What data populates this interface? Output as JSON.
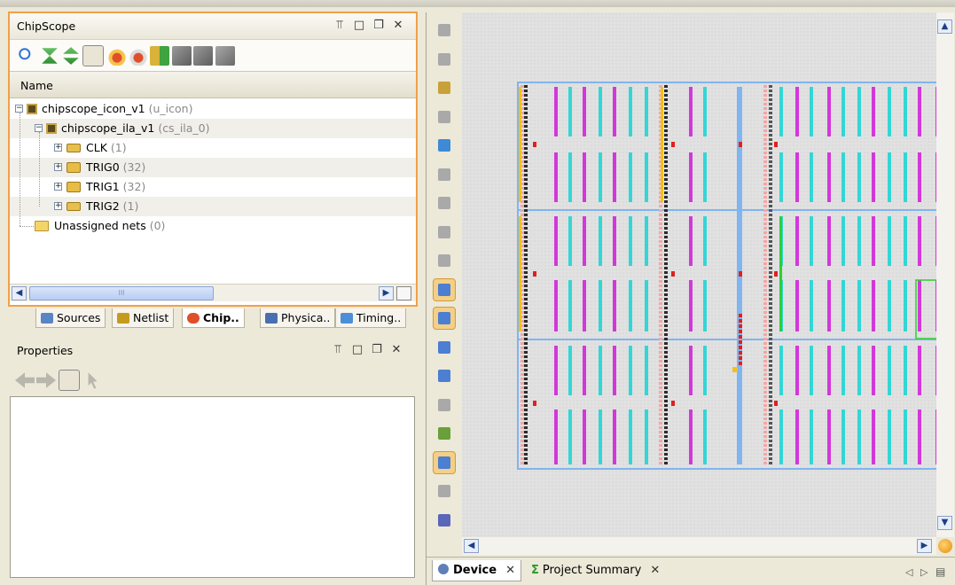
{
  "chipscope_panel": {
    "title": "ChipScope",
    "controls": [
      "pin-icon",
      "maximize-icon",
      "restore-icon",
      "close-icon"
    ],
    "control_glyphs": [
      "⫪",
      "□",
      "❐",
      "✕"
    ],
    "toolbar_icons": [
      "search-icon",
      "collapse-all-icon",
      "expand-all-icon",
      "group-by-icon",
      "add-probe-icon",
      "remove-probe-icon",
      "connect-net-icon",
      "add-trigger-icon",
      "add-data-icon",
      "delete-icon"
    ],
    "column_header": "Name",
    "tree": [
      {
        "label": "chipscope_icon_v1",
        "suffix": "(u_icon)"
      },
      {
        "label": "chipscope_ila_v1",
        "suffix": "(cs_ila_0)"
      },
      {
        "label": "CLK",
        "suffix": "(1)"
      },
      {
        "label": "TRIG0",
        "suffix": "(32)"
      },
      {
        "label": "TRIG1",
        "suffix": "(32)"
      },
      {
        "label": "TRIG2",
        "suffix": "(1)"
      },
      {
        "label": "Unassigned nets",
        "suffix": "(0)"
      }
    ],
    "expander_collapsed": "+",
    "expander_expanded": "−",
    "scroll_thumb_grip": "III",
    "scroll_left_glyph": "◀",
    "scroll_right_glyph": "▶"
  },
  "left_tabs": [
    {
      "label": "Sources",
      "icon": "sources-icon",
      "color": "#5b84c4"
    },
    {
      "label": "Netlist",
      "icon": "netlist-icon",
      "color": "#c59a1e"
    },
    {
      "label": "Chip..",
      "icon": "chipscope-icon",
      "color": "#e04e2a",
      "active": true
    },
    {
      "label": "Physica..",
      "icon": "physical-icon",
      "color": "#4a6fb0"
    },
    {
      "label": "Timing..",
      "icon": "timing-icon",
      "color": "#4d8fd6"
    }
  ],
  "properties_panel": {
    "title": "Properties",
    "controls": [
      "pin-icon",
      "maximize-icon",
      "restore-icon",
      "close-icon"
    ],
    "control_glyphs": [
      "⫪",
      "□",
      "❐",
      "✕"
    ],
    "toolbar_icons": [
      "back-icon",
      "forward-icon",
      "settings-icon",
      "select-icon"
    ]
  },
  "device_panel": {
    "tabs": [
      {
        "label": "Device",
        "icon": "device-icon",
        "active": true
      },
      {
        "label": "Project Summary",
        "icon": "sigma-icon",
        "active": false
      }
    ],
    "close_glyph": "✕",
    "right_glyphs": [
      "◁",
      "▷",
      "▤"
    ],
    "vtoolbar": [
      "back-icon",
      "forward-icon",
      "select-area-icon",
      "pan-icon",
      "add-pblock-icon",
      "place-icon",
      "route-icon",
      "show-io-icon",
      "show-clock-icon",
      "routing-icon",
      "zoom-fit-icon",
      "relocate-icon",
      "draw-icon",
      "cross-probe-icon",
      "mark-icon",
      "unmark-icon",
      "unplace-icon",
      "zoom-icon"
    ],
    "vtoolbar_pressed": [
      9,
      10,
      15
    ],
    "scroll_up_glyph": "▲",
    "scroll_down_glyph": "▼",
    "scroll_left_glyph": "◀",
    "scroll_right_glyph": "▶"
  },
  "colors": {
    "accent_orange": "#f0a04a",
    "fp_blue": "#80b5ef",
    "fp_magenta": "#d238d9",
    "fp_cyan": "#33d6d6",
    "fp_green": "#2fcf2f",
    "fp_yellow": "#f2c11a",
    "fp_pink": "#f4a6a6",
    "fp_red": "#e02020"
  }
}
